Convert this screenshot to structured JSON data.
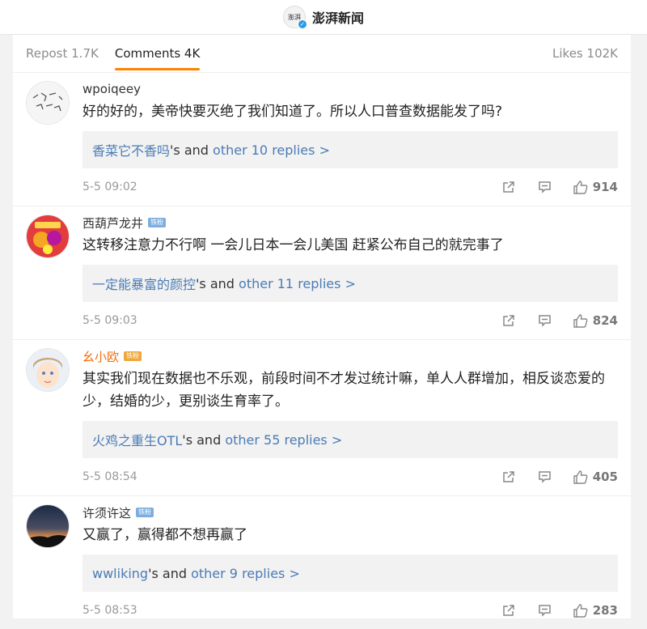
{
  "header": {
    "logo_text": "澎湃",
    "title": "澎湃新闻"
  },
  "tabs": {
    "repost": "Repost 1.7K",
    "comments": "Comments 4K",
    "likes": "Likes 102K"
  },
  "comments": [
    {
      "user": "wpoiqeey",
      "text": "好的好的，美帝快要灭绝了我们知道了。所以人口普查数据能发了吗?",
      "reply_user": "香菜它不香吗",
      "reply_mid": "'s and ",
      "reply_more": "other 10 replies >",
      "time": "5-5 09:02",
      "likes": "914"
    },
    {
      "user": "西葫芦龙井",
      "text": "这转移注意力不行啊 一会儿日本一会儿美国 赶紧公布自己的就完事了",
      "reply_user": "一定能暴富的颜控",
      "reply_mid": "'s and ",
      "reply_more": "other 11 replies >",
      "time": "5-5 09:03",
      "likes": "824"
    },
    {
      "user": "幺小欧",
      "text": "其实我们现在数据也不乐观，前段时间不才发过统计嘛，单人人群增加，相反谈恋爱的少，结婚的少，更别谈生育率了。",
      "reply_user": "火鸡之重生OTL",
      "reply_mid": "'s and ",
      "reply_more": "other 55 replies >",
      "time": "5-5 08:54",
      "likes": "405"
    },
    {
      "user": "许须许这",
      "text": "又赢了，赢得都不想再赢了",
      "reply_user": "wwliking",
      "reply_mid": "'s and ",
      "reply_more": "other 9 replies >",
      "time": "5-5 08:53",
      "likes": "283"
    }
  ],
  "colors": {
    "accent": "#ff8200",
    "link": "#4a7bb5",
    "vip_name": "#f76c0d"
  }
}
